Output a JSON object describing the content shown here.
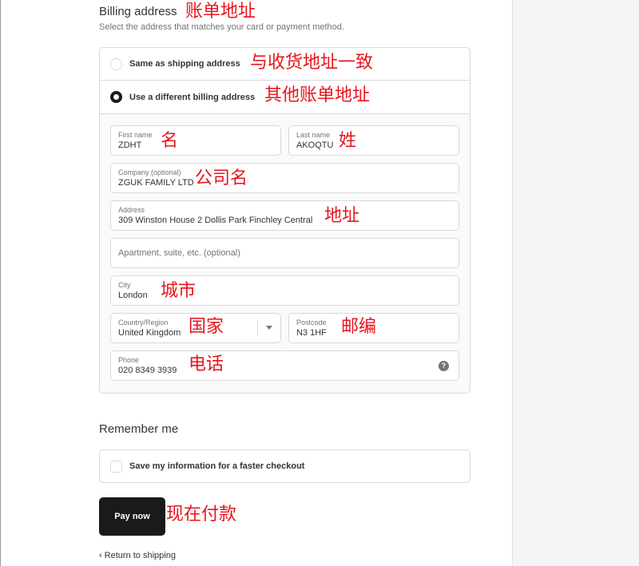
{
  "billing": {
    "title": "Billing address",
    "title_note": "账单地址",
    "subtitle": "Select the address that matches your card or payment method.",
    "option_same": "Same as shipping address",
    "option_same_note": "与收货地址一致",
    "option_different": "Use a different billing address",
    "option_different_note": "其他账单地址",
    "selected": "different"
  },
  "form": {
    "first_name": {
      "label": "First name",
      "value": "ZDHT",
      "note": "名"
    },
    "last_name": {
      "label": "Last name",
      "value": "AKOQTU",
      "note": "姓"
    },
    "company": {
      "label": "Company (optional)",
      "value": "ZGUK FAMILY LTD",
      "note": "公司名"
    },
    "address": {
      "label": "Address",
      "value": "309 Winston House 2 Dollis Park Finchley Central",
      "note": "地址"
    },
    "apartment": {
      "placeholder": "Apartment, suite, etc. (optional)"
    },
    "city": {
      "label": "City",
      "value": "London",
      "note": "城市"
    },
    "country": {
      "label": "Country/Region",
      "value": "United Kingdom",
      "note": "国家"
    },
    "postcode": {
      "label": "Postcode",
      "value": "N3 1HF",
      "note": "邮编"
    },
    "phone": {
      "label": "Phone",
      "value": "020 8349 3939",
      "note": "电话",
      "help_icon": "?"
    }
  },
  "remember": {
    "title": "Remember me",
    "checkbox_label": "Save my information for a faster checkout",
    "checked": false
  },
  "actions": {
    "pay_label": "Pay now",
    "pay_note": "现在付款",
    "return_label": "Return to shipping",
    "return_icon": "‹"
  },
  "colors": {
    "annotation": "#e8141c",
    "button_bg": "#1a1a1a",
    "border": "#d9d9d9"
  }
}
